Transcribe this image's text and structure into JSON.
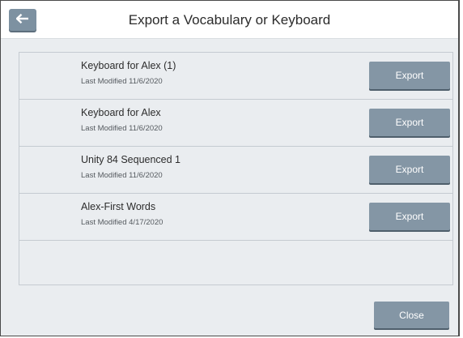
{
  "dialog": {
    "title": "Export a Vocabulary or Keyboard",
    "back_icon": "arrow-left-icon",
    "close_label": "Close"
  },
  "items": [
    {
      "name": "Keyboard for Alex (1)",
      "modified": "Last Modified 11/6/2020",
      "action_label": "Export"
    },
    {
      "name": "Keyboard for Alex",
      "modified": "Last Modified 11/6/2020",
      "action_label": "Export"
    },
    {
      "name": "Unity 84 Sequenced 1",
      "modified": "Last Modified 11/6/2020",
      "action_label": "Export"
    },
    {
      "name": "Alex-First Words",
      "modified": "Last Modified 4/17/2020",
      "action_label": "Export"
    }
  ],
  "colors": {
    "button": "#8496a5",
    "button_shadow": "#4f5f6c",
    "panel": "#eaedf0",
    "back_button": "#7d91a1"
  }
}
